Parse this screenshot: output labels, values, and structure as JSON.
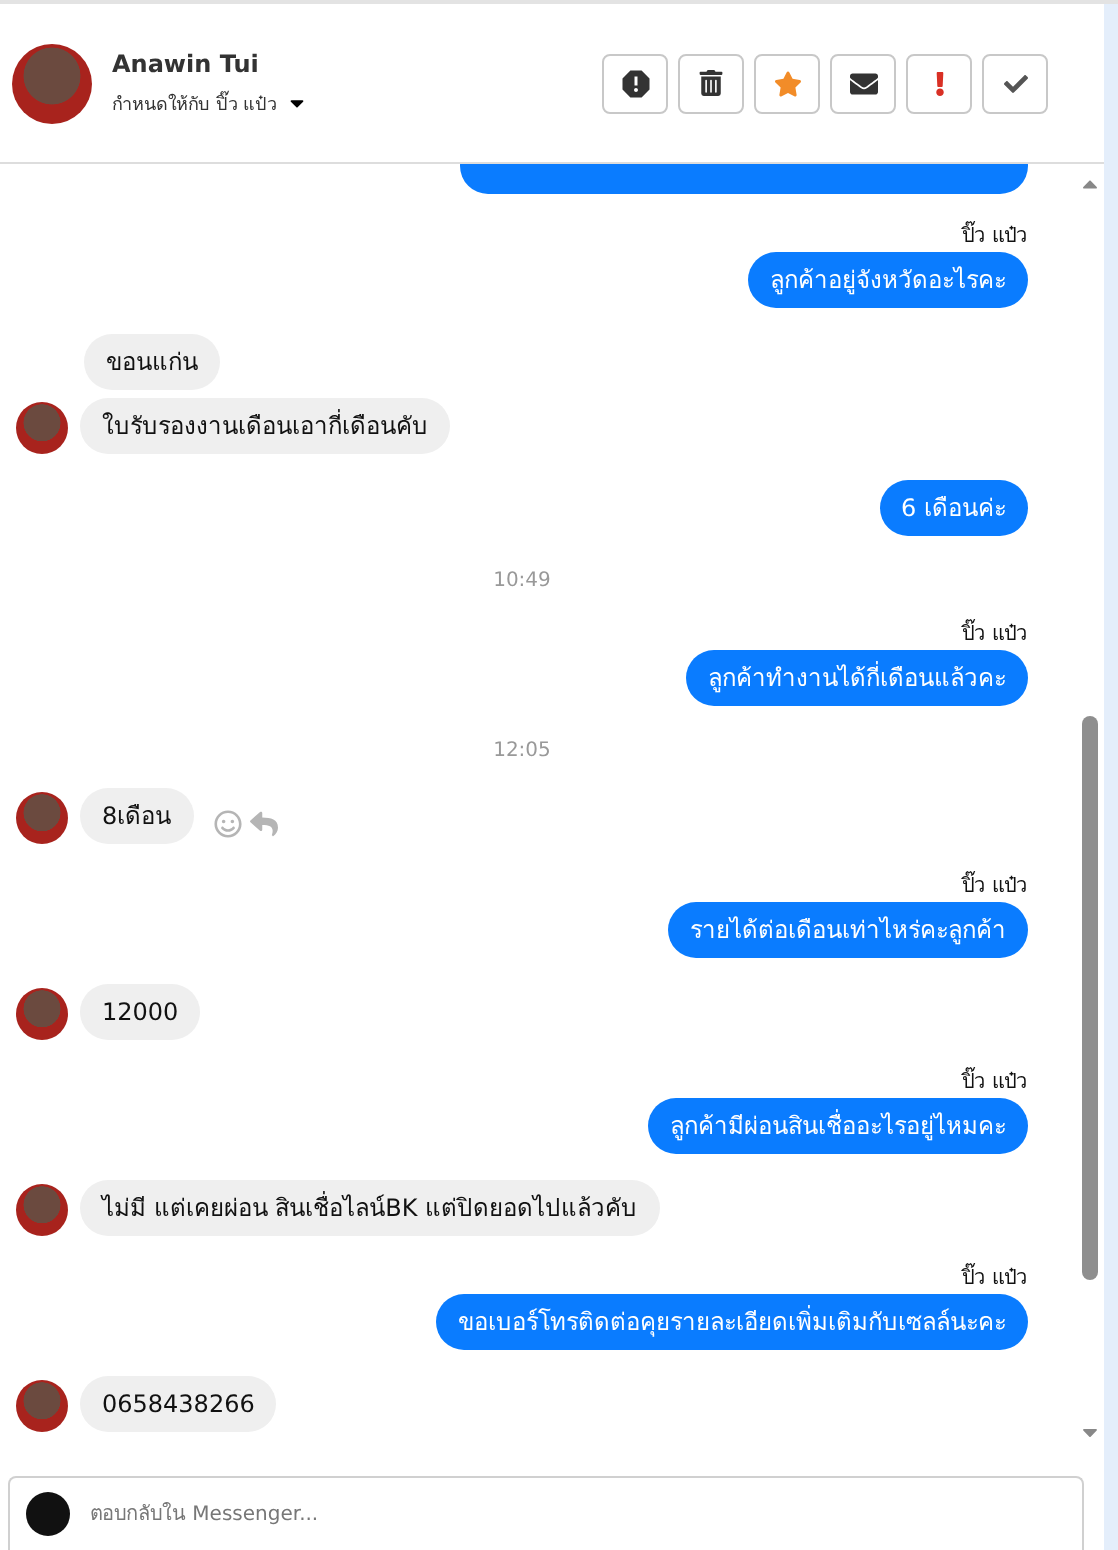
{
  "header": {
    "name": "Anawin Tui",
    "assigned_to": "กำหนดให้กับ ปิ๊ว แป๋ว",
    "actions": [
      {
        "kind": "spam"
      },
      {
        "kind": "delete"
      },
      {
        "kind": "star"
      },
      {
        "kind": "unread"
      },
      {
        "kind": "important"
      },
      {
        "kind": "done"
      }
    ]
  },
  "messages": [
    {
      "kind": "clipped"
    },
    {
      "kind": "sent",
      "sender": "ปิ๊ว แป๋ว",
      "text": "ลูกค้าอยู่จังหวัดอะไรคะ"
    },
    {
      "kind": "received",
      "avatar": false,
      "text": "ขอนแก่น"
    },
    {
      "kind": "received",
      "avatar": true,
      "text": "ใบรับรองงานเดือนเอากี่เดือนคับ"
    },
    {
      "kind": "sent",
      "text": "6 เดือนค่ะ"
    },
    {
      "kind": "time",
      "text": "10:49"
    },
    {
      "kind": "sent",
      "sender": "ปิ๊ว แป๋ว",
      "text": "ลูกค้าทำงานได้กี่เดือนแล้วคะ"
    },
    {
      "kind": "time",
      "text": "12:05"
    },
    {
      "kind": "received",
      "avatar": true,
      "actions": true,
      "text": "8เดือน"
    },
    {
      "kind": "sent",
      "sender": "ปิ๊ว แป๋ว",
      "text": "รายได้ต่อเดือนเท่าไหร่คะลูกค้า"
    },
    {
      "kind": "received",
      "avatar": true,
      "text": "12000"
    },
    {
      "kind": "sent",
      "sender": "ปิ๊ว แป๋ว",
      "text": "ลูกค้ามีผ่อนสินเชื่ออะไรอยู่ไหมคะ"
    },
    {
      "kind": "received",
      "avatar": true,
      "text": "ไม่มี แต่เคยผ่อน สินเชื่อไลน์BK แต่ปิดยอดไปแล้วคับ"
    },
    {
      "kind": "sent",
      "sender": "ปิ๊ว แป๋ว",
      "text": "ขอเบอร์โทรติดต่อคุยรายละเอียดเพิ่มเติมกับเซลล์นะคะ"
    },
    {
      "kind": "received",
      "avatar": true,
      "text": "0658438266"
    }
  ],
  "composer": {
    "placeholder": "ตอบกลับใน Messenger..."
  }
}
